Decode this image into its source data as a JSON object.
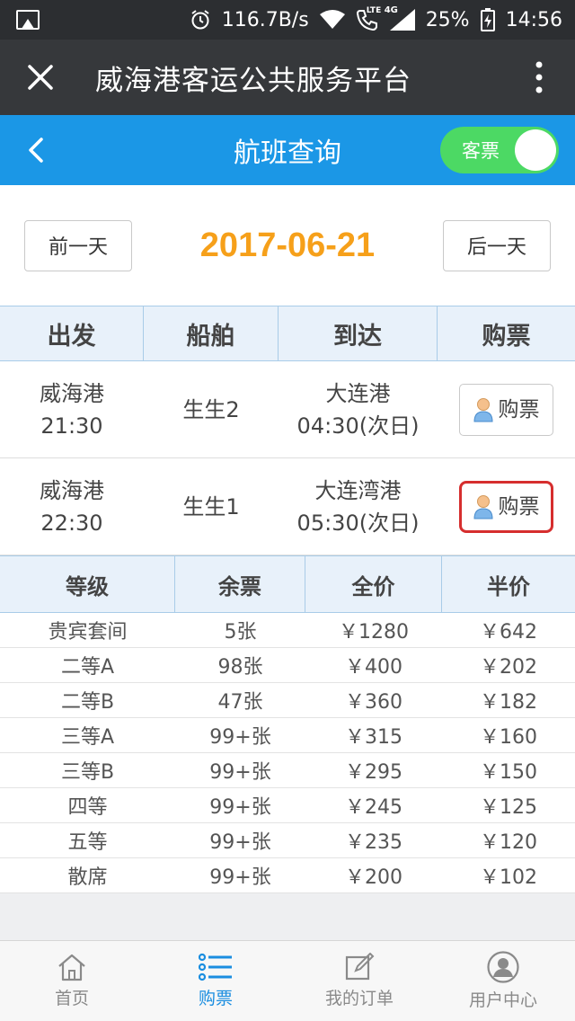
{
  "status_bar": {
    "net_speed": "116.7B/s",
    "lte": "LTE",
    "net_type": "4G",
    "battery": "25%",
    "time": "14:56"
  },
  "app_bar": {
    "title": "威海港客运公共服务平台"
  },
  "header": {
    "title": "航班查询",
    "toggle_label": "客票"
  },
  "date_nav": {
    "prev_label": "前一天",
    "date": "2017-06-21",
    "next_label": "后一天"
  },
  "voyage_table": {
    "headers": [
      "出发",
      "船舶",
      "到达",
      "购票"
    ],
    "rows": [
      {
        "depart_port": "威海港",
        "depart_time": "21:30",
        "ship": "生生2",
        "arrive_port": "大连港",
        "arrive_time": "04:30(次日)",
        "buy_label": "购票"
      },
      {
        "depart_port": "威海港",
        "depart_time": "22:30",
        "ship": "生生1",
        "arrive_port": "大连湾港",
        "arrive_time": "05:30(次日)",
        "buy_label": "购票"
      }
    ]
  },
  "cabin_table": {
    "headers": [
      "等级",
      "余票",
      "全价",
      "半价"
    ],
    "rows": [
      [
        "贵宾套间",
        "5张",
        "￥1280",
        "￥642"
      ],
      [
        "二等A",
        "98张",
        "￥400",
        "￥202"
      ],
      [
        "二等B",
        "47张",
        "￥360",
        "￥182"
      ],
      [
        "三等A",
        "99+张",
        "￥315",
        "￥160"
      ],
      [
        "三等B",
        "99+张",
        "￥295",
        "￥150"
      ],
      [
        "四等",
        "99+张",
        "￥245",
        "￥125"
      ],
      [
        "五等",
        "99+张",
        "￥235",
        "￥120"
      ],
      [
        "散席",
        "99+张",
        "￥200",
        "￥102"
      ]
    ]
  },
  "tab_bar": {
    "items": [
      {
        "label": "首页",
        "icon": "home-icon"
      },
      {
        "label": "购票",
        "icon": "list-icon"
      },
      {
        "label": "我的订单",
        "icon": "edit-icon"
      },
      {
        "label": "用户中心",
        "icon": "user-icon"
      }
    ],
    "active_index": 1
  },
  "colors": {
    "accent": "#1b97e6",
    "date": "#f6a01a",
    "toggle_on": "#4cd964",
    "selected_border": "#d62e2e"
  }
}
